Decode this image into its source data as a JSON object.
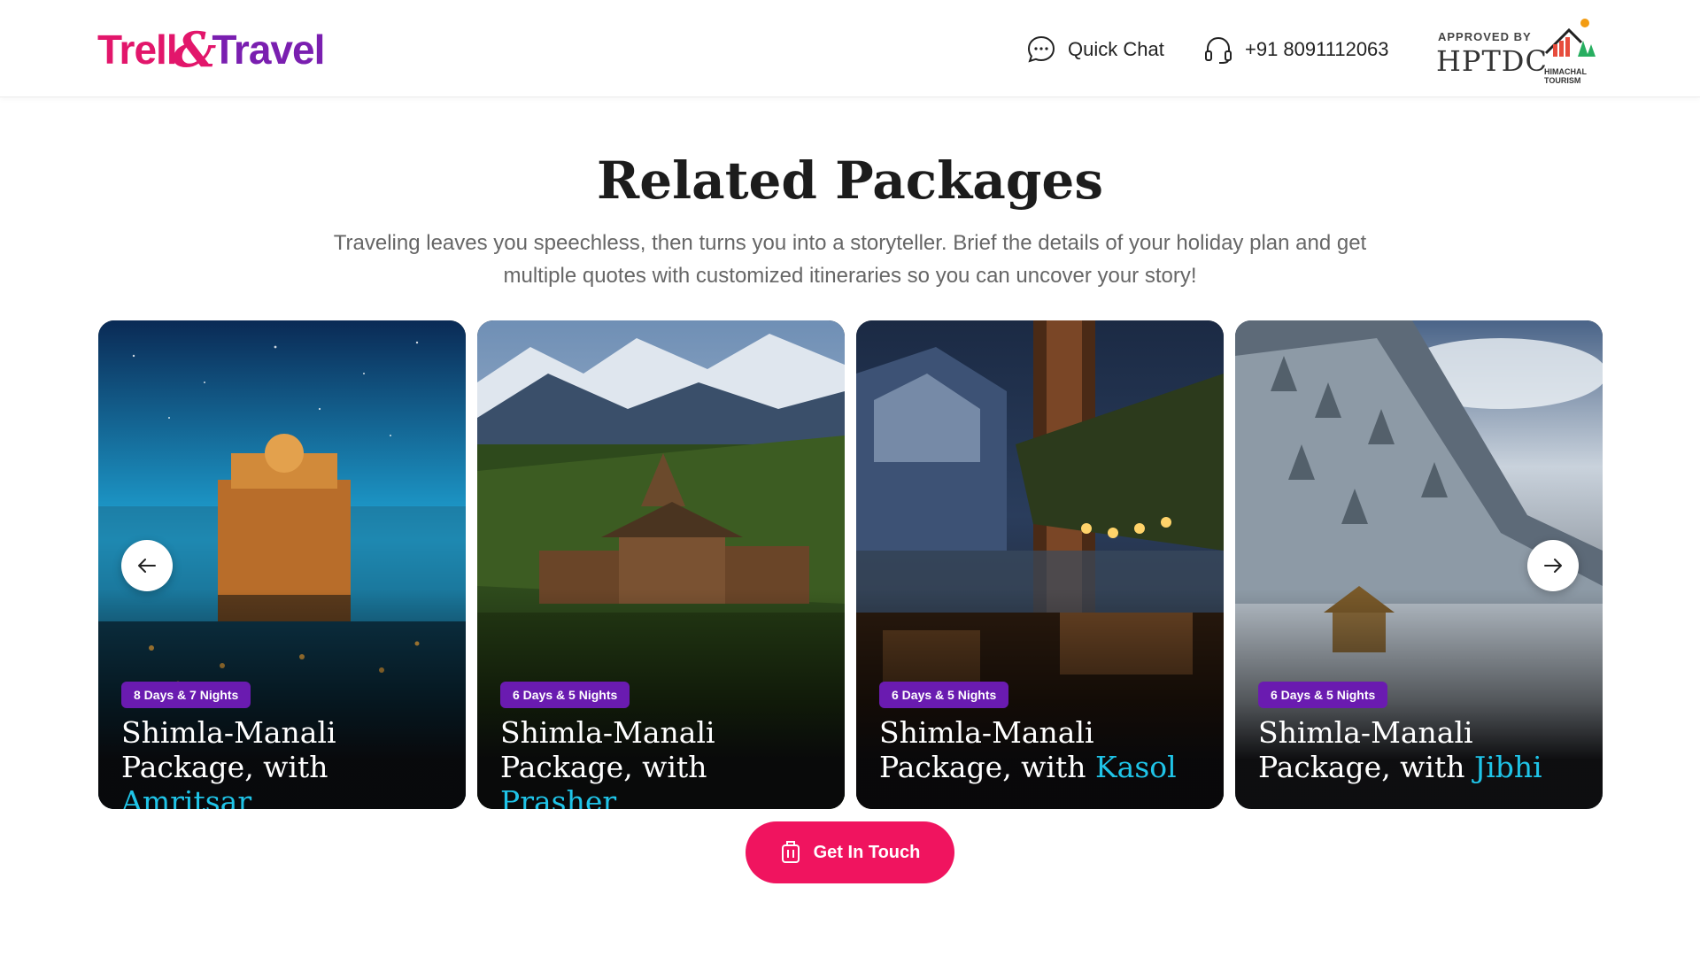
{
  "header": {
    "logo": {
      "part1": "Trell",
      "amp": "&",
      "part2": "Travel"
    },
    "quick_chat": {
      "label": "Quick Chat",
      "icon": "chat-bubble-icon"
    },
    "phone": {
      "label": "+91 8091112063",
      "icon": "headset-icon"
    },
    "approval": {
      "small": "APPROVED BY",
      "big": "HPTDC",
      "tag_line1": "HIMACHAL",
      "tag_line2": "TOURISM"
    }
  },
  "section": {
    "title": "Related Packages",
    "description": "Traveling leaves you speechless, then turns you into a storyteller. Brief the details of your holiday plan and get multiple quotes with customized itineraries so you can uncover your story!"
  },
  "cards": [
    {
      "duration": "8 Days & 7 Nights",
      "title_line1": "Shimla-Manali",
      "title_prefix": "Package, with ",
      "highlight": "Amritsar"
    },
    {
      "duration": "6 Days & 5 Nights",
      "title_line1": "Shimla-Manali",
      "title_prefix": "Package, with ",
      "highlight": "Prasher"
    },
    {
      "duration": "6 Days & 5 Nights",
      "title_line1": "Shimla-Manali",
      "title_prefix": "Package, with ",
      "highlight": "Kasol"
    },
    {
      "duration": "6 Days & 5 Nights",
      "title_line1": "Shimla-Manali",
      "title_prefix": "Package, with ",
      "highlight": "Jibhi"
    }
  ],
  "carousel": {
    "prev_icon": "arrow-left-icon",
    "next_icon": "arrow-right-icon"
  },
  "cta": {
    "label": "Get In Touch",
    "icon": "luggage-icon"
  },
  "colors": {
    "brand_pink": "#e2166b",
    "brand_purple": "#7a1fb0",
    "badge": "#6a1bb0",
    "highlight": "#1fc4e8",
    "cta": "#f0145f"
  }
}
